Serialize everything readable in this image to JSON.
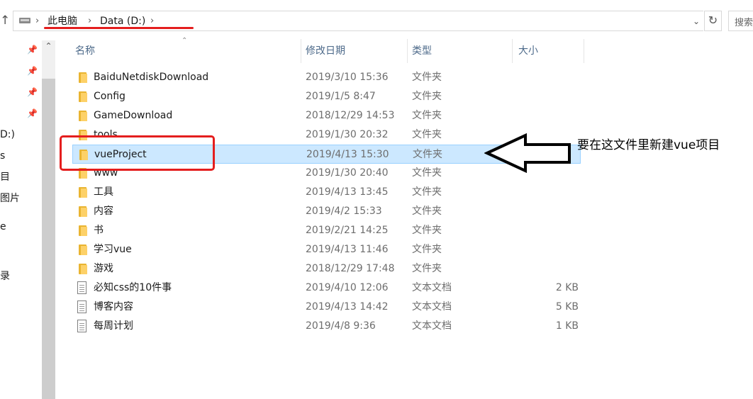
{
  "address_bar": {
    "crumbs": [
      "此电脑",
      "Data (D:)"
    ],
    "search_placeholder": "搜索"
  },
  "nav": {
    "labels": [
      "D:)",
      "s",
      "目",
      "图片",
      "e",
      "录"
    ]
  },
  "columns": {
    "name": "名称",
    "date": "修改日期",
    "type": "类型",
    "size": "大小"
  },
  "files": [
    {
      "name": "BaiduNetdiskDownload",
      "date": "2019/3/10 15:36",
      "type": "文件夹",
      "size": "",
      "kind": "folder"
    },
    {
      "name": "Config",
      "date": "2019/1/5 8:47",
      "type": "文件夹",
      "size": "",
      "kind": "folder"
    },
    {
      "name": "GameDownload",
      "date": "2018/12/29 14:53",
      "type": "文件夹",
      "size": "",
      "kind": "folder"
    },
    {
      "name": "tools",
      "date": "2019/1/30 20:32",
      "type": "文件夹",
      "size": "",
      "kind": "folder"
    },
    {
      "name": "vueProject",
      "date": "2019/4/13 15:30",
      "type": "文件夹",
      "size": "",
      "kind": "folder",
      "selected": true
    },
    {
      "name": "www",
      "date": "2019/1/30 20:40",
      "type": "文件夹",
      "size": "",
      "kind": "folder"
    },
    {
      "name": "工具",
      "date": "2019/4/13 13:45",
      "type": "文件夹",
      "size": "",
      "kind": "folder"
    },
    {
      "name": "内容",
      "date": "2019/4/2 15:33",
      "type": "文件夹",
      "size": "",
      "kind": "folder"
    },
    {
      "name": "书",
      "date": "2019/2/21 14:25",
      "type": "文件夹",
      "size": "",
      "kind": "folder"
    },
    {
      "name": "学习vue",
      "date": "2019/4/13 11:46",
      "type": "文件夹",
      "size": "",
      "kind": "folder"
    },
    {
      "name": "游戏",
      "date": "2018/12/29 17:48",
      "type": "文件夹",
      "size": "",
      "kind": "folder"
    },
    {
      "name": "必知css的10件事",
      "date": "2019/4/10 12:06",
      "type": "文本文档",
      "size": "2 KB",
      "kind": "file"
    },
    {
      "name": "博客内容",
      "date": "2019/4/13 14:42",
      "type": "文本文档",
      "size": "5 KB",
      "kind": "file"
    },
    {
      "name": "每周计划",
      "date": "2019/4/8 9:36",
      "type": "文本文档",
      "size": "1 KB",
      "kind": "file"
    }
  ],
  "annotation": {
    "text": "要在这文件里新建vue项目",
    "color": "#e41e1e"
  },
  "colors": {
    "selection_bg": "#cce8ff",
    "selection_border": "#99d1ff",
    "header_text": "#4d6a8a",
    "folder": "#fdd168"
  }
}
